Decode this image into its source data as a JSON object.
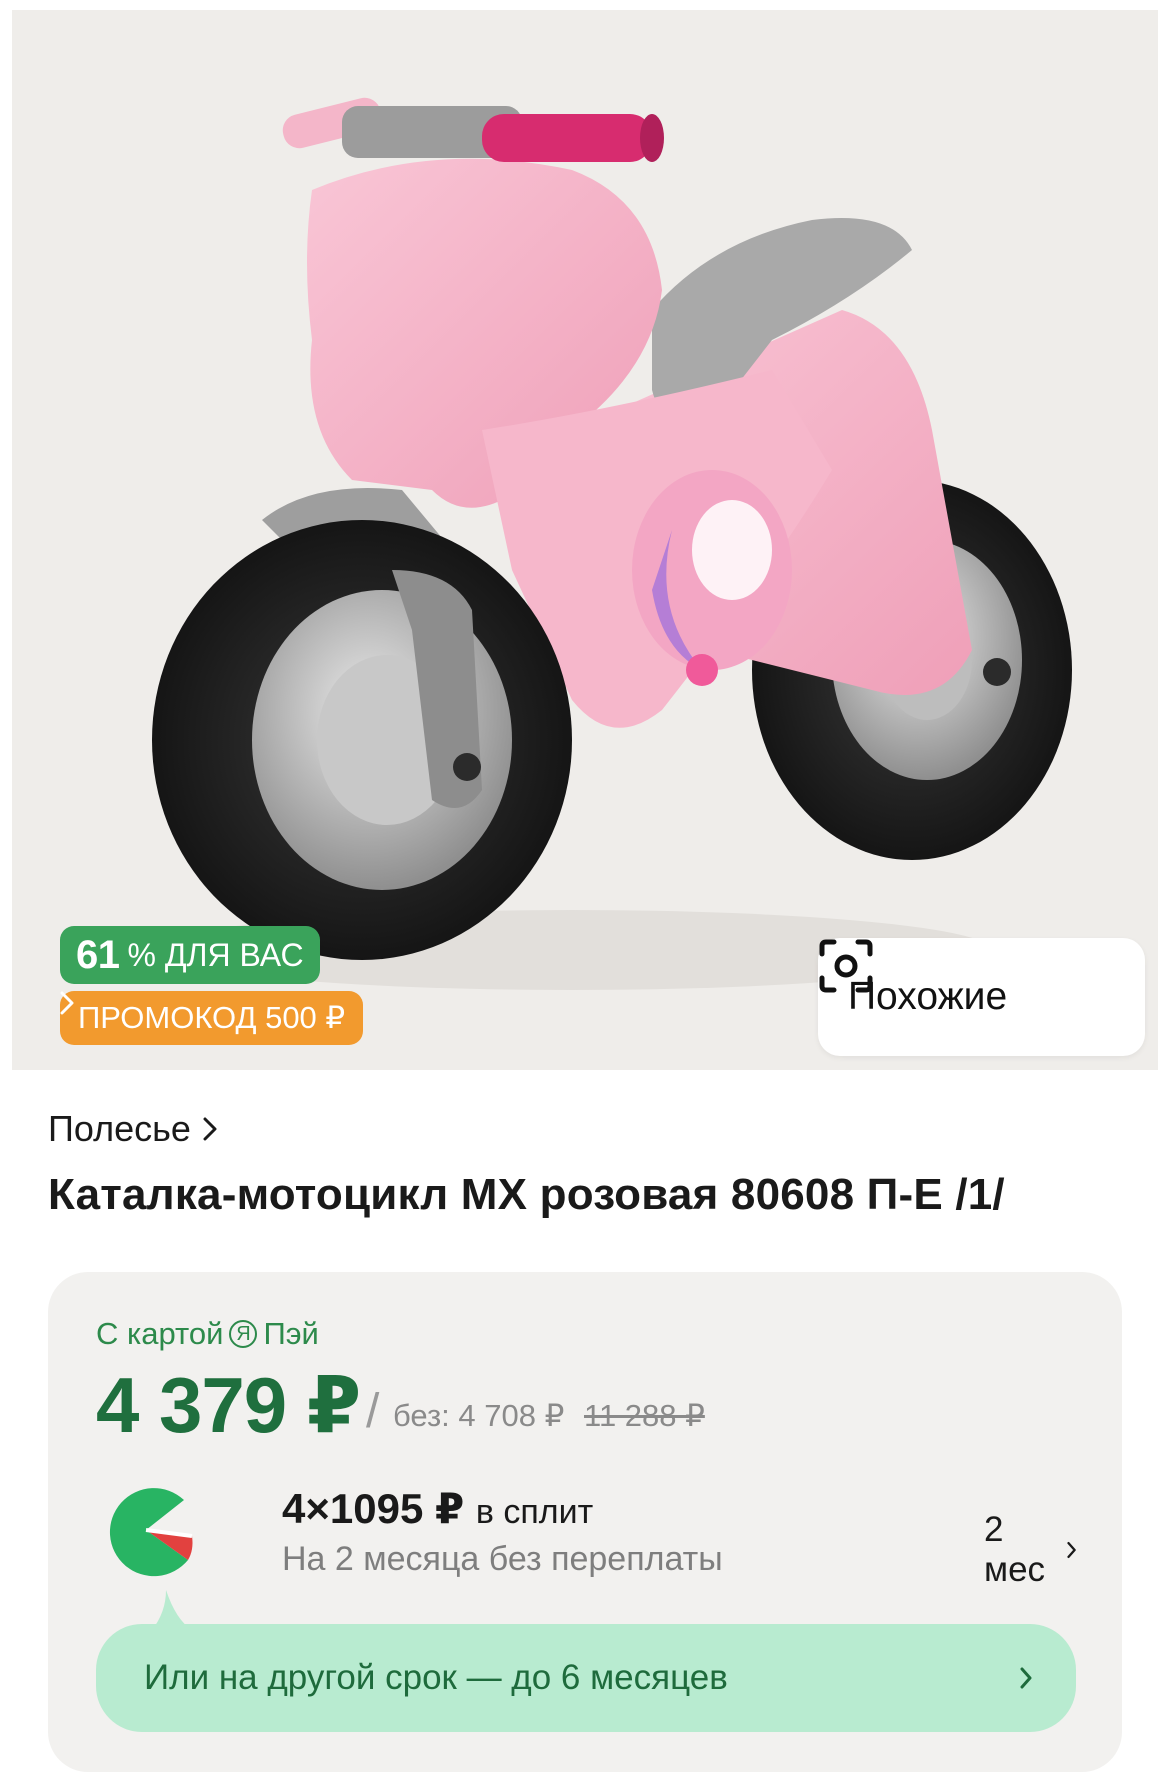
{
  "product_image": {
    "description_icon": "pink-ride-on-motorcycle-image",
    "discount_badge": {
      "percent": "61",
      "suffix": "% ДЛЯ ВАС"
    },
    "promo_badge": {
      "label": "ПРОМОКОД 500 ₽"
    },
    "similar_button": {
      "label": "Похожие"
    }
  },
  "brand": {
    "name": "Полесье"
  },
  "product": {
    "title": "Каталка-мотоцикл MX розовая 80608 П-Е /1/"
  },
  "pricing": {
    "caption_prefix": "С картой",
    "caption_badge": "Я",
    "caption_suffix": "Пэй",
    "price": "4 379 ₽",
    "slash": "/",
    "price_without": "без: 4 708 ₽",
    "price_old": "11 288 ₽"
  },
  "split": {
    "amount": "4×1095 ₽",
    "amount_suffix": "в сплит",
    "description": "На 2 месяца без переплаты",
    "period": "2 мес"
  },
  "term_option": {
    "label": "Или на другой срок — до 6 месяцев"
  },
  "colors": {
    "accent_green": "#3aa35b",
    "price_green": "#1f6f3e",
    "promo_orange": "#f29a2e",
    "pill_green": "#b8ebd0"
  }
}
